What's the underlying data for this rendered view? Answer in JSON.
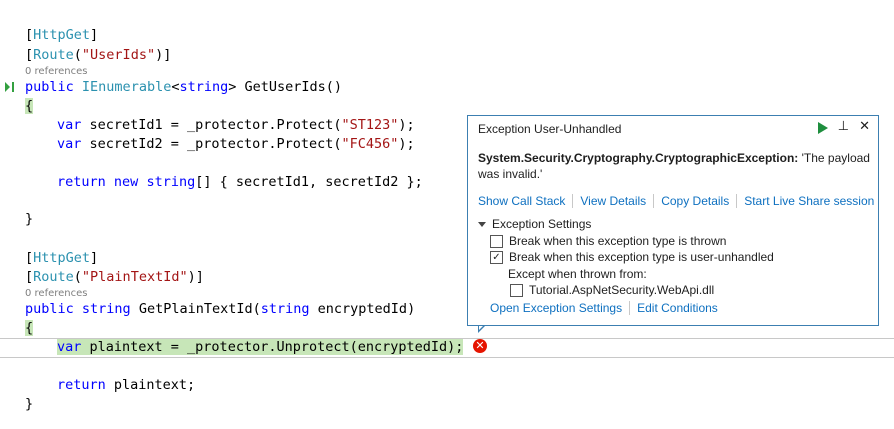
{
  "code": {
    "l1_attr": "HttpGet",
    "l2_attr": "Route",
    "l2_arg": "\"UserIds\"",
    "l3_refs": "0 references",
    "l4_kw": "public",
    "l4_type": "IEnumerable",
    "l4_generic": "string",
    "l4_method": "GetUserIds()",
    "l5_brace": "{",
    "l6_kw": "var",
    "l6_rest": " secretId1 = _protector.Protect(",
    "l6_str": "\"ST123\"",
    "l6_end": ");",
    "l7_kw": "var",
    "l7_rest": " secretId2 = _protector.Protect(",
    "l7_str": "\"FC456\"",
    "l7_end": ");",
    "l8_kw1": "return",
    "l8_kw2": "new",
    "l8_kw3": "string",
    "l8_rest": "[] { secretId1, secretId2 };",
    "l9_brace": "}",
    "l10_attr": "HttpGet",
    "l11_attr": "Route",
    "l11_arg": "\"PlainTextId\"",
    "l12_refs": "0 references",
    "l13_kw1": "public",
    "l13_kw2": "string",
    "l13_method": " GetPlainTextId(",
    "l13_kw3": "string",
    "l13_rest": " encryptedId)",
    "l14_brace": "{",
    "l15_kw": "var",
    "l15_rest": " plaintext = _protector.Unprotect(encryptedId);",
    "l16_kw": "return",
    "l16_rest": " plaintext;",
    "l17_brace": "}"
  },
  "popup": {
    "title": "Exception User-Unhandled",
    "exception_type": "System.Security.Cryptography.CryptographicException:",
    "exception_message": " 'The payload was invalid.'",
    "links": {
      "show_call_stack": "Show Call Stack",
      "view_details": "View Details",
      "copy_details": "Copy Details",
      "live_share": "Start Live Share session"
    },
    "settings_header": "Exception Settings",
    "opt_thrown": "Break when this exception type is thrown",
    "opt_unhandled": "Break when this exception type is user-unhandled",
    "except_label": "Except when thrown from:",
    "module": "Tutorial.AspNetSecurity.WebApi.dll",
    "open_settings": "Open Exception Settings",
    "edit_conditions": "Edit Conditions",
    "opt_thrown_checked": false,
    "opt_unhandled_checked": true,
    "module_checked": false
  },
  "icons": {
    "continue": "play-icon",
    "pin": "pin-icon",
    "close": "close-icon",
    "error": "error-icon",
    "exec_pointer": "execution-pointer-icon"
  },
  "colors": {
    "keyword": "#0000ff",
    "type": "#2b91af",
    "string": "#a31515",
    "highlight": "#c7e6b8",
    "link": "#0e70c0",
    "popup_border": "#3c7fb1",
    "error": "#e51400"
  }
}
